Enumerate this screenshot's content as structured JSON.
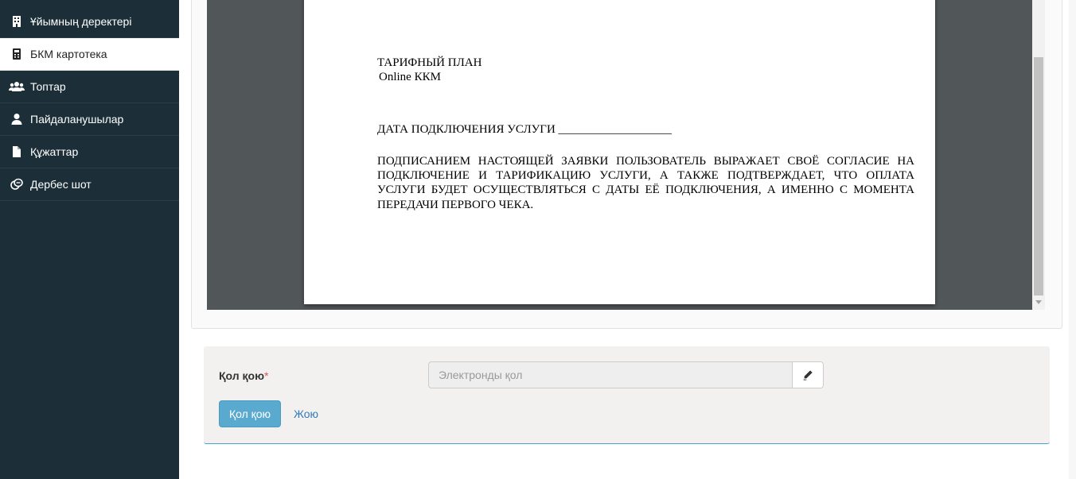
{
  "sidebar": {
    "items": [
      {
        "label": "Ұйымның деректері",
        "icon": "building-icon"
      },
      {
        "label": "БКМ картотека",
        "icon": "calculator-icon",
        "active": true
      },
      {
        "label": "Топтар",
        "icon": "users-icon"
      },
      {
        "label": "Пайдаланушылар",
        "icon": "user-icon"
      },
      {
        "label": "Құжаттар",
        "icon": "file-icon"
      },
      {
        "label": "Дербес шот",
        "icon": "coins-icon"
      }
    ]
  },
  "document": {
    "title": "ТАРИФНЫЙ ПЛАН",
    "subtitle": "Online ККМ",
    "date_line": "ДАТА ПОДКЛЮЧЕНИЯ УСЛУГИ ___________________",
    "agreement": "ПОДПИСАНИЕМ НАСТОЯЩЕЙ ЗАЯВКИ ПОЛЬЗОВАТЕЛЬ ВЫРАЖАЕТ СВОЁ СОГЛАСИЕ НА ПОДКЛЮЧЕНИЕ И ТАРИФИКАЦИЮ УСЛУГИ, А ТАКЖЕ ПОДТВЕРЖДАЕТ, ЧТО ОПЛАТА УСЛУГИ БУДЕТ ОСУЩЕСТВЛЯТЬСЯ С ДАТЫ ЕЁ ПОДКЛЮЧЕНИЯ, А ИМЕННО С МОМЕНТА ПЕРЕДАЧИ ПЕРВОГО ЧЕКА."
  },
  "sign_form": {
    "label": "Қол қою",
    "required_mark": "*",
    "input_value": "",
    "input_placeholder": "Электронды қол",
    "pen_icon": "pencil-icon",
    "submit_label": "Қол қою",
    "cancel_label": "Жою"
  },
  "colors": {
    "sidebar_bg": "#1c2f38",
    "viewer_bg": "#515659",
    "primary_button": "#5aa9cf",
    "link": "#337ab7",
    "required": "#d9534f"
  }
}
